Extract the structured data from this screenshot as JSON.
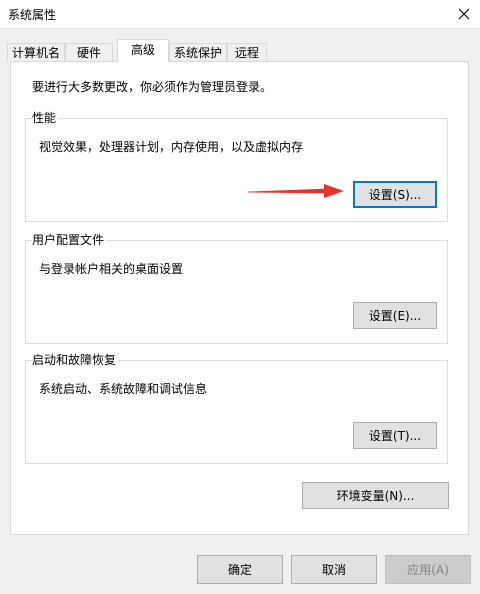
{
  "window": {
    "title": "系统属性"
  },
  "tabs": [
    {
      "label": "计算机名",
      "active": false
    },
    {
      "label": "硬件",
      "active": false
    },
    {
      "label": "高级",
      "active": true
    },
    {
      "label": "系统保护",
      "active": false
    },
    {
      "label": "远程",
      "active": false
    }
  ],
  "advanced": {
    "admin_note": "要进行大多数更改，你必须作为管理员登录。",
    "performance": {
      "title": "性能",
      "description": "视觉效果，处理器计划，内存使用，以及虚拟内存",
      "button": "设置(S)..."
    },
    "user_profiles": {
      "title": "用户配置文件",
      "description": "与登录帐户相关的桌面设置",
      "button": "设置(E)..."
    },
    "startup_recovery": {
      "title": "启动和故障恢复",
      "description": "系统启动、系统故障和调试信息",
      "button": "设置(T)..."
    },
    "env_button": "环境变量(N)..."
  },
  "footer": {
    "ok": "确定",
    "cancel": "取消",
    "apply": "应用(A)"
  },
  "colors": {
    "accent": "#0078d7",
    "annotation_arrow": "#e8322b"
  },
  "icons": {
    "close": "close-icon",
    "annotation": "red-arrow-icon"
  }
}
